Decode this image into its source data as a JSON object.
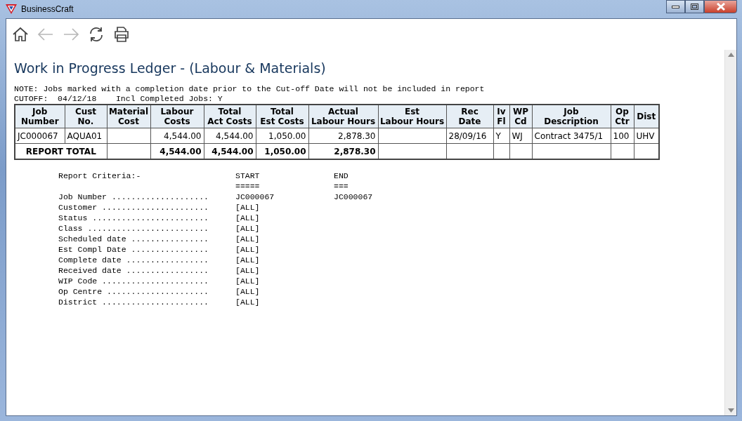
{
  "window": {
    "title": "BusinessCraft"
  },
  "toolbar": [
    {
      "kind": "home",
      "disabled": false
    },
    {
      "kind": "back",
      "disabled": true
    },
    {
      "kind": "forward",
      "disabled": true
    },
    {
      "kind": "refresh",
      "disabled": false
    },
    {
      "kind": "print",
      "disabled": false
    }
  ],
  "report": {
    "title": "Work in Progress Ledger - (Labour & Materials)",
    "note": "NOTE: Jobs marked with a completion date prior to the Cut-off Date will not be included in report",
    "cutoff": "CUTOFF:  04/12/18    Incl Completed Jobs: Y",
    "table": {
      "columns": [
        "Job\nNumber",
        "Cust\nNo.",
        "Material\nCost",
        "Labour\nCosts",
        "Total\nAct Costs",
        "Total\nEst Costs",
        "Actual\nLabour Hours",
        "Est\nLabour Hours",
        "Rec\nDate",
        "Iv\nFl",
        "WP\nCd",
        "Job\nDescription",
        "Op\nCtr",
        "Dist"
      ],
      "rows": [
        [
          "JC000067",
          "AQUA01",
          null,
          "4,544.00",
          "4,544.00",
          "1,050.00",
          "2,878.30",
          null,
          "28/09/16",
          "Y",
          "WJ",
          "Contract 3475/1",
          "100",
          "UHV"
        ]
      ],
      "total": {
        "label": "REPORT TOTAL",
        "cells": [
          null,
          "4,544.00",
          "4,544.00",
          "1,050.00",
          "2,878.30",
          null,
          null,
          null,
          null,
          null,
          null,
          null
        ]
      }
    },
    "criteria": {
      "heading": "Report Criteria:-",
      "start_heading": "START",
      "start_rule": "=====",
      "end_heading": "END",
      "end_rule": "===",
      "rows": [
        {
          "label": "Job Number ....................",
          "start": "JC000067",
          "end": "JC000067"
        },
        {
          "label": "Customer ......................",
          "start": "[ALL]"
        },
        {
          "label": "Status ........................",
          "start": "[ALL]"
        },
        {
          "label": "Class .........................",
          "start": "[ALL]"
        },
        {
          "label": "Scheduled date ................",
          "start": "[ALL]"
        },
        {
          "label": "Est Compl Date ................",
          "start": "[ALL]"
        },
        {
          "label": "Complete date .................",
          "start": "[ALL]"
        },
        {
          "label": "Received date .................",
          "start": "[ALL]"
        },
        {
          "label": "WIP Code ......................",
          "start": "[ALL]"
        },
        {
          "label": "Op Centre .....................",
          "start": "[ALL]"
        },
        {
          "label": "District ......................",
          "start": "[ALL]"
        }
      ]
    }
  }
}
